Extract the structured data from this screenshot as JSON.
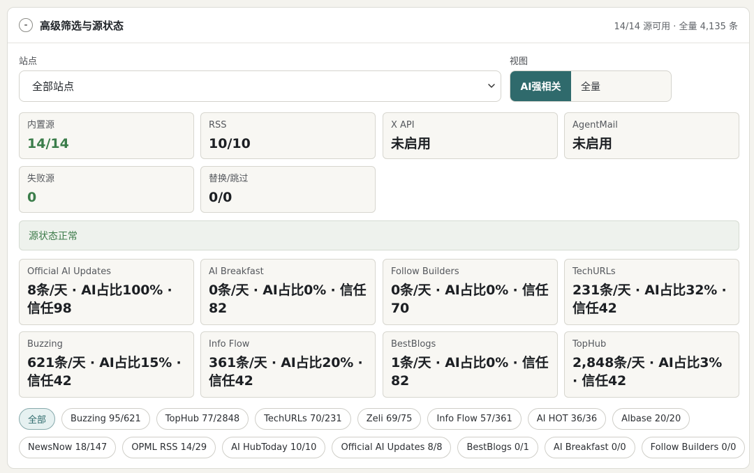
{
  "header": {
    "toggle_label": "-",
    "title": "高级筛选与源状态",
    "summary": "14/14 源可用 · 全量 4,135 条"
  },
  "site_filter": {
    "label": "站点",
    "value": "全部站点"
  },
  "view": {
    "label": "视图",
    "options": [
      {
        "label": "AI强相关",
        "active": true
      },
      {
        "label": "全量",
        "active": false
      }
    ]
  },
  "stats": [
    {
      "label": "内置源",
      "value": "14/14"
    },
    {
      "label": "RSS",
      "value": "10/10"
    },
    {
      "label": "X API",
      "value": "未启用"
    },
    {
      "label": "AgentMail",
      "value": "未启用"
    },
    {
      "label": "失败源",
      "value": "0"
    },
    {
      "label": "替换/跳过",
      "value": "0/0"
    }
  ],
  "status_message": "源状态正常",
  "sources": [
    {
      "name": "Official AI Updates",
      "detail": "8条/天 · AI占比100% · 信任98"
    },
    {
      "name": "AI Breakfast",
      "detail": "0条/天 · AI占比0% · 信任82"
    },
    {
      "name": "Follow Builders",
      "detail": "0条/天 · AI占比0% · 信任70"
    },
    {
      "name": "TechURLs",
      "detail": "231条/天 · AI占比32% · 信任42"
    },
    {
      "name": "Buzzing",
      "detail": "621条/天 · AI占比15% · 信任42"
    },
    {
      "name": "Info Flow",
      "detail": "361条/天 · AI占比20% · 信任42"
    },
    {
      "name": "BestBlogs",
      "detail": "1条/天 · AI占比0% · 信任82"
    },
    {
      "name": "TopHub",
      "detail": "2,848条/天 · AI占比3% · 信任42"
    }
  ],
  "chips_row1": [
    {
      "label": "全部",
      "active": true
    },
    {
      "label": "Buzzing 95/621"
    },
    {
      "label": "TopHub 77/2848"
    },
    {
      "label": "TechURLs 70/231"
    },
    {
      "label": "Zeli 69/75"
    },
    {
      "label": "Info Flow 57/361"
    },
    {
      "label": "AI HOT 36/36"
    },
    {
      "label": "Albase 20/20"
    }
  ],
  "chips_row2": [
    {
      "label": "NewsNow 18/147"
    },
    {
      "label": "OPML RSS 14/29"
    },
    {
      "label": "AI HubToday 10/10"
    },
    {
      "label": "Official AI Updates 8/8"
    },
    {
      "label": "BestBlogs 0/1"
    },
    {
      "label": "AI Breakfast 0/0"
    },
    {
      "label": "Follow Builders 0/0"
    }
  ],
  "colors": {
    "accent": "#2f6a6c",
    "ok_green": "#3b7d4a"
  }
}
